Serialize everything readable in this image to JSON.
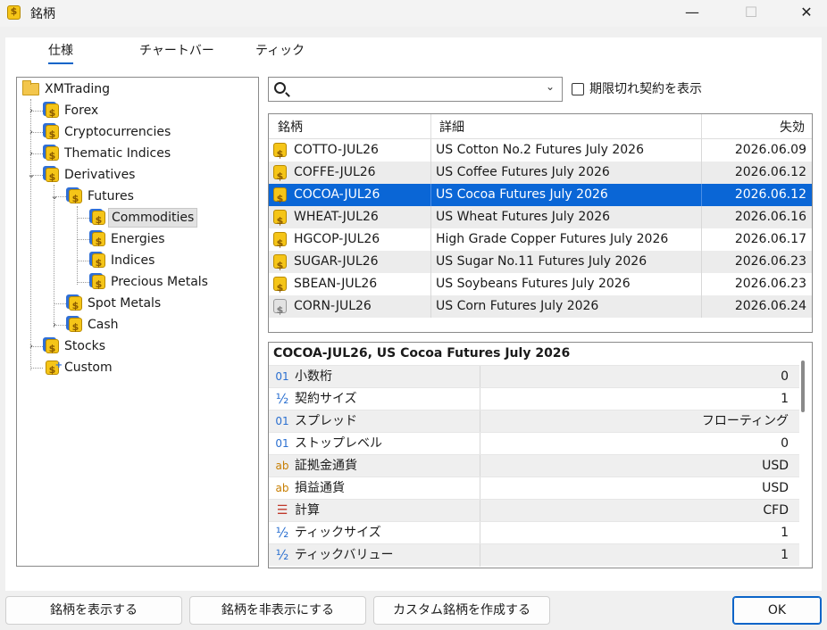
{
  "window": {
    "title": "銘柄",
    "controls": [
      "minimize",
      "maximize",
      "close"
    ]
  },
  "tabs": [
    {
      "label": "仕様",
      "active": true
    },
    {
      "label": "チャートバー",
      "active": false
    },
    {
      "label": "ティック",
      "active": false
    }
  ],
  "tree": {
    "root": "XMTrading",
    "items": [
      {
        "label": "Forex",
        "expanded": false
      },
      {
        "label": "Cryptocurrencies",
        "expanded": false
      },
      {
        "label": "Thematic Indices",
        "expanded": false
      },
      {
        "label": "Derivatives",
        "expanded": true
      },
      {
        "label": "Futures",
        "expanded": true
      },
      {
        "label": "Commodities",
        "selected": true
      },
      {
        "label": "Energies"
      },
      {
        "label": "Indices"
      },
      {
        "label": "Precious Metals"
      },
      {
        "label": "Spot Metals"
      },
      {
        "label": "Cash",
        "expanded": false
      },
      {
        "label": "Stocks",
        "expanded": false
      },
      {
        "label": "Custom"
      }
    ]
  },
  "search": {
    "value": "",
    "placeholder": ""
  },
  "expired_checkbox": {
    "label": "期限切れ契約を表示",
    "checked": false
  },
  "symbols": {
    "headers": [
      "銘柄",
      "詳細",
      "失効"
    ],
    "rows": [
      {
        "symbol": "COTTO-JUL26",
        "desc": "US Cotton No.2 Futures July 2026",
        "expiry": "2026.06.09",
        "icon": "coin"
      },
      {
        "symbol": "COFFE-JUL26",
        "desc": "US Coffee Futures July 2026",
        "expiry": "2026.06.12",
        "icon": "coin"
      },
      {
        "symbol": "COCOA-JUL26",
        "desc": "US Cocoa Futures July 2026",
        "expiry": "2026.06.12",
        "icon": "coin",
        "selected": true
      },
      {
        "symbol": "WHEAT-JUL26",
        "desc": "US Wheat Futures July 2026",
        "expiry": "2026.06.16",
        "icon": "coin"
      },
      {
        "symbol": "HGCOP-JUL26",
        "desc": "High Grade Copper Futures July 2026",
        "expiry": "2026.06.17",
        "icon": "coin"
      },
      {
        "symbol": "SUGAR-JUL26",
        "desc": "US Sugar No.11 Futures July 2026",
        "expiry": "2026.06.23",
        "icon": "coin"
      },
      {
        "symbol": "SBEAN-JUL26",
        "desc": "US Soybeans Futures July 2026",
        "expiry": "2026.06.23",
        "icon": "coin"
      },
      {
        "symbol": "CORN-JUL26",
        "desc": "US Corn Futures July 2026",
        "expiry": "2026.06.24",
        "icon": "coin-grey"
      }
    ]
  },
  "details": {
    "title": "COCOA-JUL26, US Cocoa Futures July 2026",
    "rows": [
      {
        "icon": "01",
        "name": "小数桁",
        "value": "0"
      },
      {
        "icon": "½",
        "name": "契約サイズ",
        "value": "1"
      },
      {
        "icon": "01",
        "name": "スプレッド",
        "value": "フローティング"
      },
      {
        "icon": "01",
        "name": "ストップレベル",
        "value": "0"
      },
      {
        "icon": "ab",
        "name": "証拠金通貨",
        "value": "USD"
      },
      {
        "icon": "ab",
        "name": "損益通貨",
        "value": "USD"
      },
      {
        "icon": "calc",
        "name": "計算",
        "value": "CFD"
      },
      {
        "icon": "½",
        "name": "ティックサイズ",
        "value": "1"
      },
      {
        "icon": "½",
        "name": "ティックバリュー",
        "value": "1"
      }
    ]
  },
  "buttons": {
    "show": "銘柄を表示する",
    "hide": "銘柄を非表示にする",
    "create_custom": "カスタム銘柄を作成する",
    "ok": "OK"
  },
  "colors": {
    "selection": "#0a66d6",
    "tab_underline": "#0a64c8",
    "coin": "#f5c518"
  }
}
